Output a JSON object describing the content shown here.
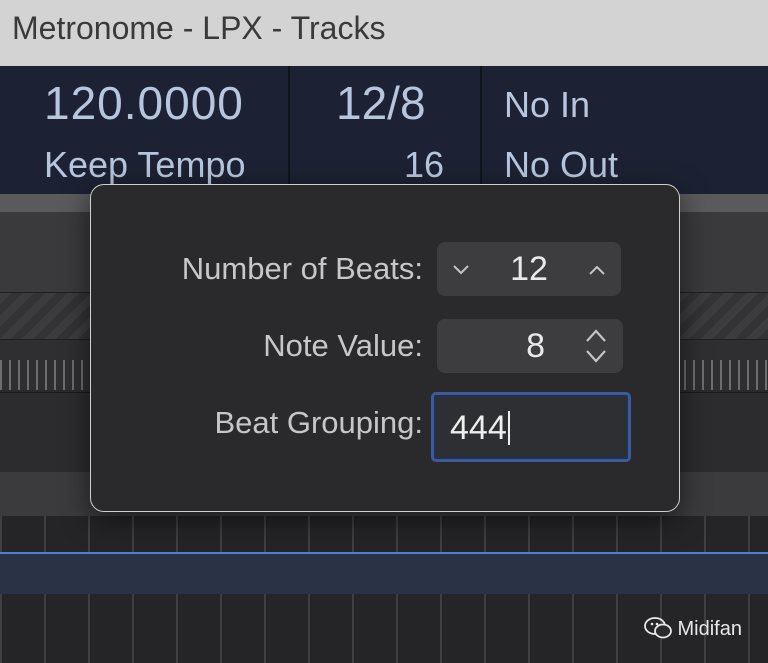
{
  "window": {
    "title": "Metronome - LPX - Tracks"
  },
  "lcd": {
    "tempo": "120.0000",
    "tempo_mode": "Keep Tempo",
    "signature_top": "12/8",
    "signature_bottom": "16",
    "midi_in": "No In",
    "midi_out": "No Out"
  },
  "popover": {
    "beats_label": "Number of Beats:",
    "beats_value": "12",
    "note_label": "Note Value:",
    "note_value": "8",
    "grouping_label": "Beat Grouping:",
    "grouping_value": "444",
    "icons": {
      "decrement": "chevron-down-icon",
      "increment": "chevron-up-icon",
      "updown": "updown-chevron-icon"
    }
  },
  "watermark": {
    "text": "Midifan"
  },
  "colors": {
    "accent": "#3c5a9c",
    "lcd_background": "#1c2233",
    "lcd_text": "#b7c6dd",
    "popover_background": "#2a2a2c"
  }
}
